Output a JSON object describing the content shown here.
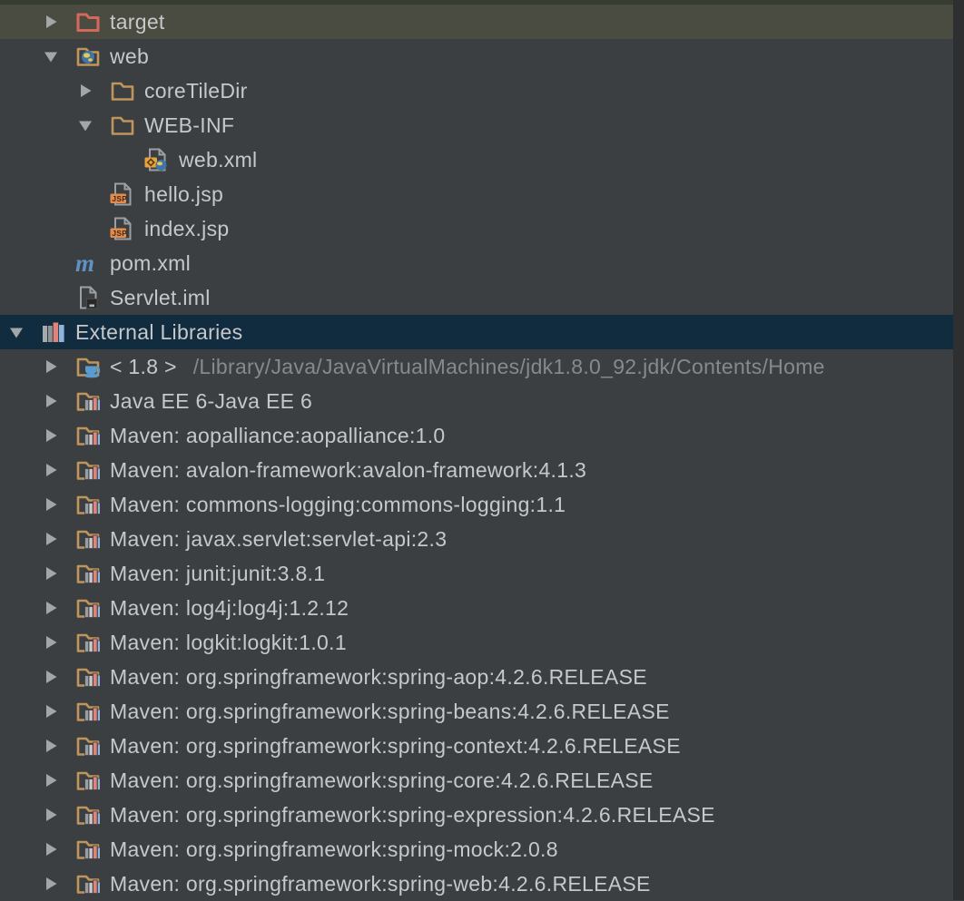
{
  "colors": {
    "bg": "#3c3f41",
    "hover_row": "#4a4c41",
    "selected_row": "#122c3f",
    "top_sliver": "#363c32",
    "right_edge": "#2d2f31",
    "text": "#c6c8ca",
    "dim_text": "#87898b",
    "arrow": "#a3a6a9",
    "folder_tan": "#c0955c",
    "folder_red": "#d4685c",
    "page_outline": "#9d9fa2",
    "jsp_badge": "#e28c50",
    "xml_badge": "#e8a33c",
    "maven_blue": "#5e92c2",
    "globe_blue": "#3f74a8",
    "globe_yellow": "#e5c94f",
    "cup_blue": "#5c9bd0",
    "book_gray": "#9b9da0",
    "book_red": "#e0837a",
    "book_blue": "#8db4da"
  },
  "tree": {
    "items": [
      {
        "label": "target",
        "level": 1,
        "arrow": "right",
        "icon": "excluded-folder",
        "state": "hover"
      },
      {
        "label": "web",
        "level": 1,
        "arrow": "down",
        "icon": "web-folder"
      },
      {
        "label": "coreTileDir",
        "level": 2,
        "arrow": "right",
        "icon": "folder"
      },
      {
        "label": "WEB-INF",
        "level": 2,
        "arrow": "down",
        "icon": "folder"
      },
      {
        "label": "web.xml",
        "level": 3,
        "arrow": "none",
        "icon": "web-xml-file"
      },
      {
        "label": "hello.jsp",
        "level": 2,
        "arrow": "none",
        "icon": "jsp-file"
      },
      {
        "label": "index.jsp",
        "level": 2,
        "arrow": "none",
        "icon": "jsp-file"
      },
      {
        "label": "pom.xml",
        "level": 1,
        "arrow": "none",
        "icon": "maven-module"
      },
      {
        "label": "Servlet.iml",
        "level": 1,
        "arrow": "none",
        "icon": "iml-file"
      },
      {
        "label": "External Libraries",
        "level": 0,
        "arrow": "down",
        "icon": "libraries",
        "state": "selected"
      },
      {
        "label": "< 1.8 >",
        "suffix": "/Library/Java/JavaVirtualMachines/jdk1.8.0_92.jdk/Contents/Home",
        "level": 1,
        "arrow": "right",
        "icon": "jdk-folder"
      },
      {
        "label": "Java EE 6-Java EE 6",
        "level": 1,
        "arrow": "right",
        "icon": "library-folder"
      },
      {
        "label": "Maven: aopalliance:aopalliance:1.0",
        "level": 1,
        "arrow": "right",
        "icon": "library-folder"
      },
      {
        "label": "Maven: avalon-framework:avalon-framework:4.1.3",
        "level": 1,
        "arrow": "right",
        "icon": "library-folder"
      },
      {
        "label": "Maven: commons-logging:commons-logging:1.1",
        "level": 1,
        "arrow": "right",
        "icon": "library-folder"
      },
      {
        "label": "Maven: javax.servlet:servlet-api:2.3",
        "level": 1,
        "arrow": "right",
        "icon": "library-folder"
      },
      {
        "label": "Maven: junit:junit:3.8.1",
        "level": 1,
        "arrow": "right",
        "icon": "library-folder"
      },
      {
        "label": "Maven: log4j:log4j:1.2.12",
        "level": 1,
        "arrow": "right",
        "icon": "library-folder"
      },
      {
        "label": "Maven: logkit:logkit:1.0.1",
        "level": 1,
        "arrow": "right",
        "icon": "library-folder"
      },
      {
        "label": "Maven: org.springframework:spring-aop:4.2.6.RELEASE",
        "level": 1,
        "arrow": "right",
        "icon": "library-folder"
      },
      {
        "label": "Maven: org.springframework:spring-beans:4.2.6.RELEASE",
        "level": 1,
        "arrow": "right",
        "icon": "library-folder"
      },
      {
        "label": "Maven: org.springframework:spring-context:4.2.6.RELEASE",
        "level": 1,
        "arrow": "right",
        "icon": "library-folder"
      },
      {
        "label": "Maven: org.springframework:spring-core:4.2.6.RELEASE",
        "level": 1,
        "arrow": "right",
        "icon": "library-folder"
      },
      {
        "label": "Maven: org.springframework:spring-expression:4.2.6.RELEASE",
        "level": 1,
        "arrow": "right",
        "icon": "library-folder"
      },
      {
        "label": "Maven: org.springframework:spring-mock:2.0.8",
        "level": 1,
        "arrow": "right",
        "icon": "library-folder"
      },
      {
        "label": "Maven: org.springframework:spring-web:4.2.6.RELEASE",
        "level": 1,
        "arrow": "right",
        "icon": "library-folder"
      }
    ]
  }
}
